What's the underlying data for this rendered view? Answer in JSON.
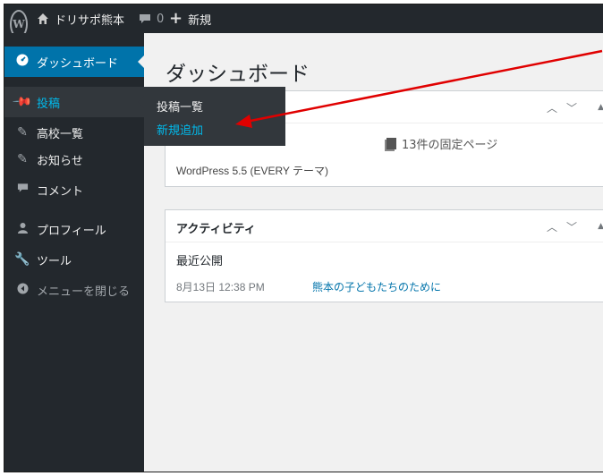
{
  "adminbar": {
    "logo": "W",
    "site_name": "ドリサポ熊本",
    "comments_count": "0",
    "new_label": "新規"
  },
  "sidebar": {
    "items": [
      {
        "label": "ダッシュボード",
        "icon": "dashboard-icon"
      },
      {
        "label": "投稿",
        "icon": "pin-icon"
      },
      {
        "label": "高校一覧",
        "icon": "pin-icon"
      },
      {
        "label": "お知らせ",
        "icon": "pin-icon"
      },
      {
        "label": "コメント",
        "icon": "comment-icon"
      },
      {
        "label": "プロフィール",
        "icon": "user-icon"
      },
      {
        "label": "ツール",
        "icon": "wrench-icon"
      },
      {
        "label": "メニューを閉じる",
        "icon": "collapse-icon"
      }
    ],
    "flyout": {
      "list_label": "投稿一覧",
      "new_label": "新規追加"
    }
  },
  "main": {
    "title": "ダッシュボード",
    "at_a_glance": {
      "pages_count": "13件の固定ページ",
      "version_text": "WordPress 5.5 (EVERY テーマ)"
    },
    "activity": {
      "title": "アクティビティ",
      "recent_label": "最近公開",
      "recent_date": "8月13日 12:38 PM",
      "recent_title": "熊本の子どもたちのために"
    }
  },
  "colors": {
    "admin_dark": "#23282d",
    "accent_blue": "#0073aa",
    "highlight_blue": "#00b9eb",
    "annotation_red": "#e00000"
  }
}
